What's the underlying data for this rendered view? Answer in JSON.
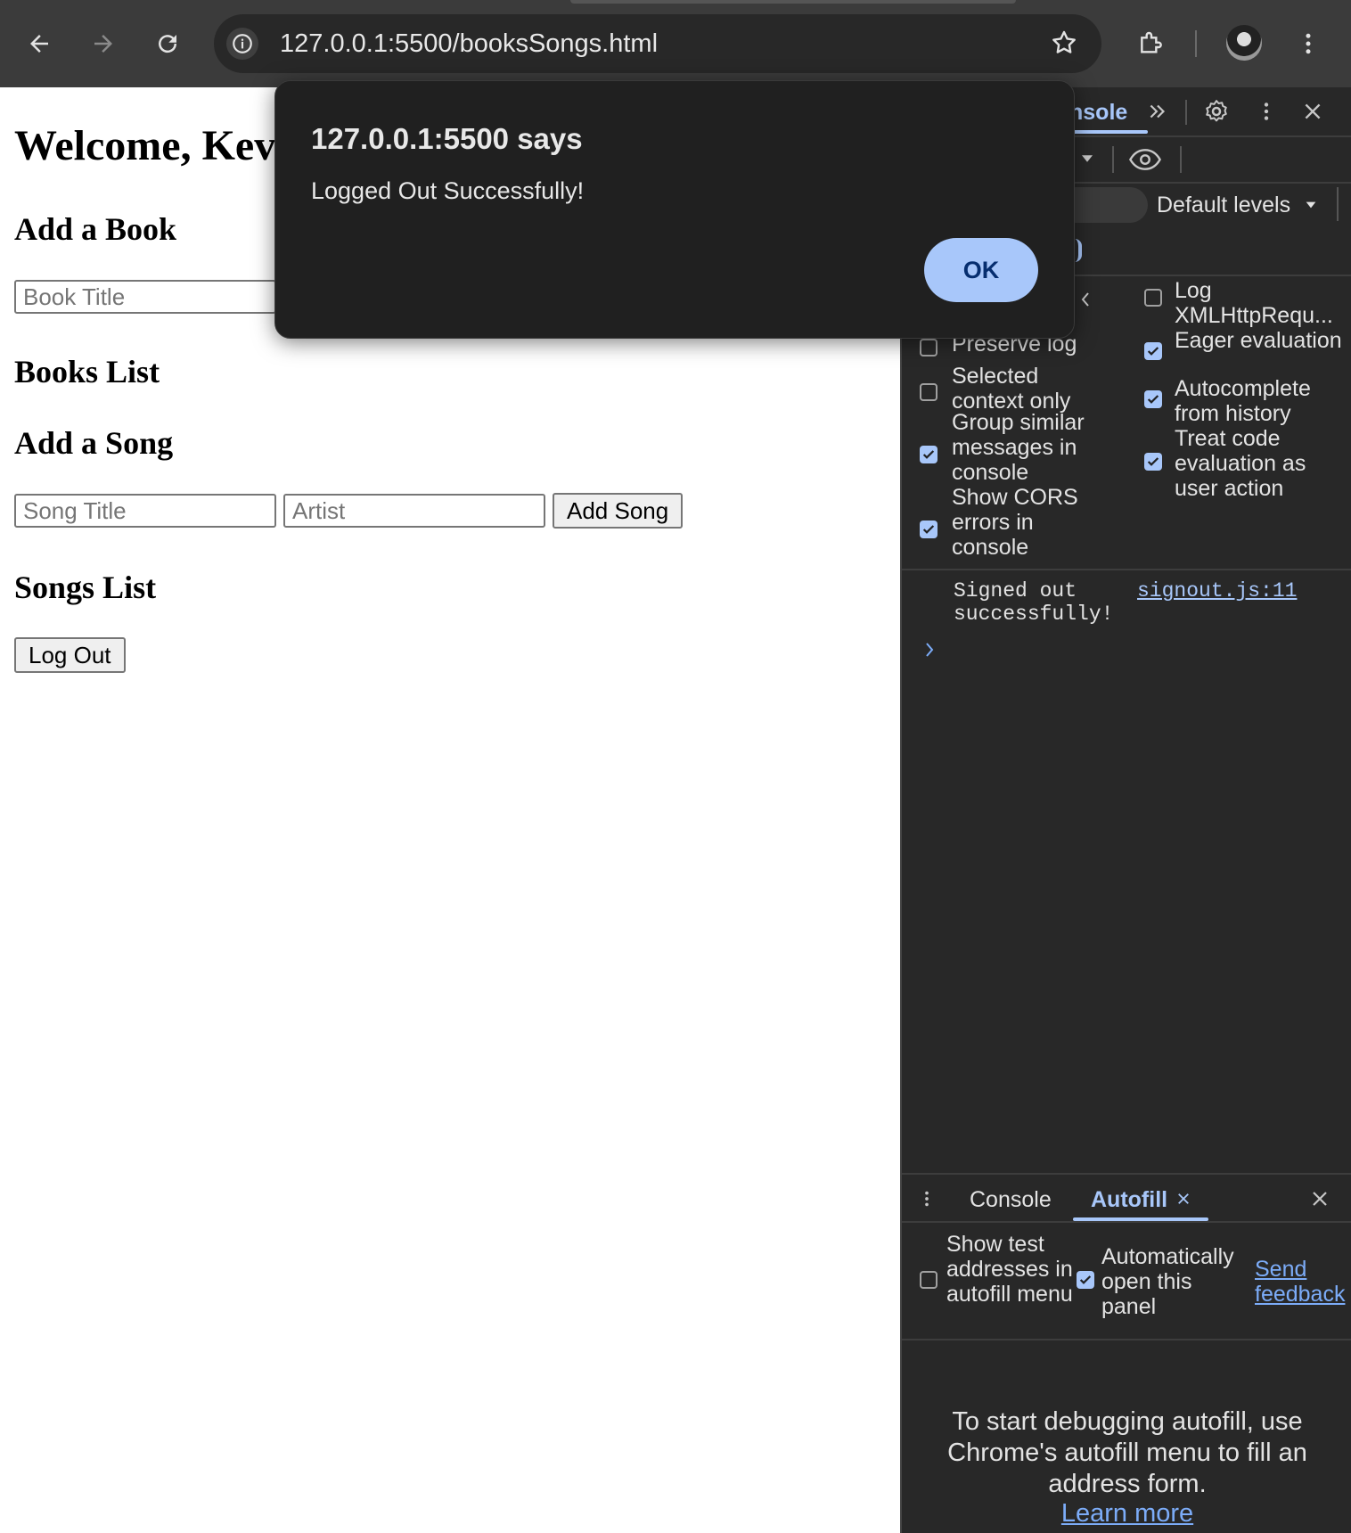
{
  "browser": {
    "url": "127.0.0.1:5500/booksSongs.html"
  },
  "page": {
    "welcome": "Welcome, Kev",
    "add_book_heading": "Add a Book",
    "book_title_placeholder": "Book Title",
    "books_list_heading": "Books List",
    "add_song_heading": "Add a Song",
    "song_title_placeholder": "Song Title",
    "artist_placeholder": "Artist",
    "add_song_button": "Add Song",
    "songs_list_heading": "Songs List",
    "logout_button": "Log Out"
  },
  "dialog": {
    "title": "127.0.0.1:5500 says",
    "message": "Logged Out Successfully!",
    "ok": "OK"
  },
  "devtools": {
    "active_tab": "nsole",
    "levels": "Default levels",
    "settings_left": [
      {
        "label": "Preserve log",
        "checked": false
      },
      {
        "label": "Selected context only",
        "checked": false
      },
      {
        "label": "Group similar messages in console",
        "checked": true
      },
      {
        "label": "Show CORS errors in console",
        "checked": true
      }
    ],
    "settings_right": [
      {
        "label": "Log XMLHttpRequ...",
        "checked": false
      },
      {
        "label": "Eager evaluation",
        "checked": true
      },
      {
        "label": "Autocomplete from history",
        "checked": true
      },
      {
        "label": "Treat code evaluation as user action",
        "checked": true
      }
    ],
    "console_message": "Signed out successfully!",
    "console_source": "signout.js:11",
    "drawer": {
      "tab_console": "Console",
      "tab_autofill": "Autofill",
      "show_test_addresses": "Show test addresses in autofill menu",
      "auto_open": "Automatically open this panel",
      "send_feedback": "Send feedback",
      "message": "To start debugging autofill, use Chrome's autofill menu to fill an address form.",
      "learn_more": "Learn more"
    }
  },
  "colors": {
    "accent": "#a8c7fa",
    "devtools_bg": "#282828",
    "chrome_bg": "#3b3b3b"
  }
}
